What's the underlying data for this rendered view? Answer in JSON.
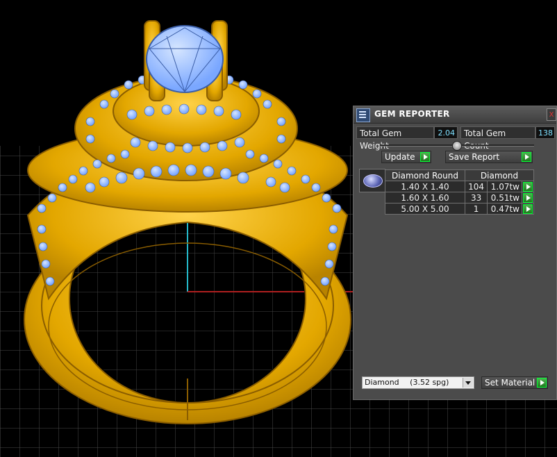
{
  "panel": {
    "title": "GEM REPORTER",
    "close_glyph": "x",
    "total_weight_label": "Total Gem Weight",
    "total_weight_value": "2.04",
    "total_count_label": "Total Gem Count",
    "total_count_value": "138",
    "update_label": "Update",
    "save_label": "Save Report",
    "table": {
      "headers": [
        "Diamond Round",
        "Diamond"
      ],
      "rows": [
        {
          "size": "1.40 X 1.40",
          "count": "104",
          "weight": "1.07tw"
        },
        {
          "size": "1.60 X 1.60",
          "count": "33",
          "weight": "0.51tw"
        },
        {
          "size": "5.00 X 5.00",
          "count": "1",
          "weight": "0.47tw"
        }
      ]
    },
    "material_name": "Diamond",
    "material_density": "(3.52 spg)",
    "set_material_label": "Set Material"
  },
  "colors": {
    "metal": "#f0b800",
    "gem": "#8fb9ff",
    "grid": "#4a4a4a",
    "panel_bg": "#4b4b4b",
    "accent_value": "#7fe0ff",
    "go_button": "#2f9a2f"
  },
  "icons": [
    "gem-reporter-app-icon",
    "close-icon",
    "play-arrow-icon",
    "gem-thumbnail-icon",
    "dropdown-arrow-icon",
    "slider-knob-icon"
  ]
}
